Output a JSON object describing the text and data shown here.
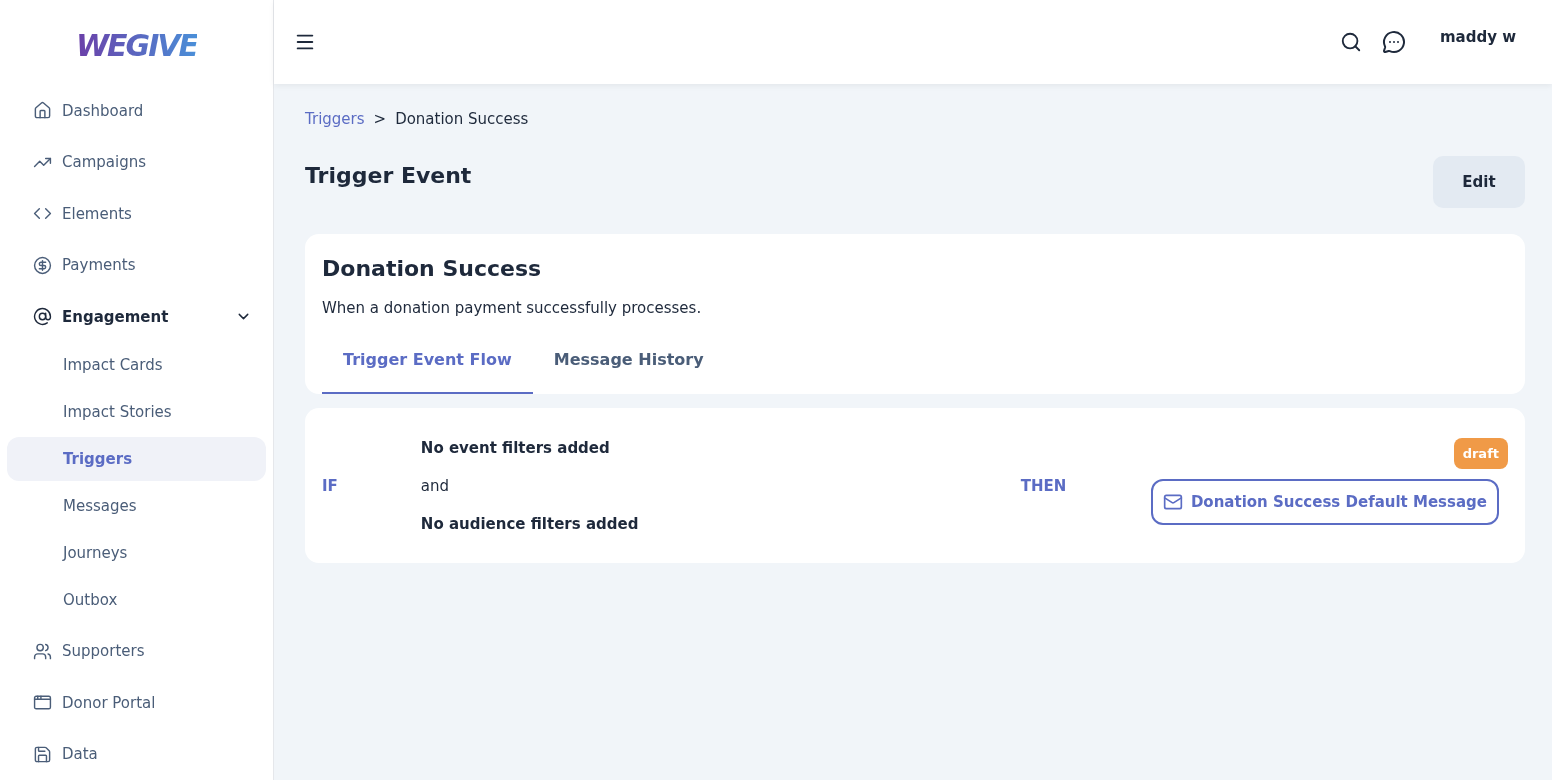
{
  "logo": "WEGIVE",
  "sidebar": {
    "items": [
      {
        "label": "Dashboard",
        "selected": false
      },
      {
        "label": "Campaigns",
        "selected": false
      },
      {
        "label": "Elements",
        "selected": false
      },
      {
        "label": "Payments",
        "selected": false
      },
      {
        "label": "Engagement",
        "selected": false,
        "expanded": true,
        "children": [
          {
            "label": "Impact Cards",
            "selected": false
          },
          {
            "label": "Impact Stories",
            "selected": false
          },
          {
            "label": "Triggers",
            "selected": true
          },
          {
            "label": "Messages",
            "selected": false
          },
          {
            "label": "Journeys",
            "selected": false
          },
          {
            "label": "Outbox",
            "selected": false
          }
        ]
      },
      {
        "label": "Supporters",
        "selected": false
      },
      {
        "label": "Donor Portal",
        "selected": false
      },
      {
        "label": "Data",
        "selected": false
      }
    ]
  },
  "header": {
    "user": "maddy w"
  },
  "breadcrumb": {
    "link": "Triggers",
    "separator": ">",
    "current": "Donation Success"
  },
  "page_title": "Trigger Event",
  "edit_button": "Edit",
  "trigger": {
    "title": "Donation Success",
    "description": "When a donation payment successfully processes.",
    "tabs": [
      {
        "label": "Trigger Event Flow",
        "selected": true
      },
      {
        "label": "Message History",
        "selected": false
      }
    ]
  },
  "flow": {
    "if_label": "IF",
    "event_filters": "No event filters added",
    "joiner": "and",
    "audience_filters": "No audience filters added",
    "then_label": "THEN",
    "status": "draft",
    "message": "Donation Success Default Message"
  }
}
